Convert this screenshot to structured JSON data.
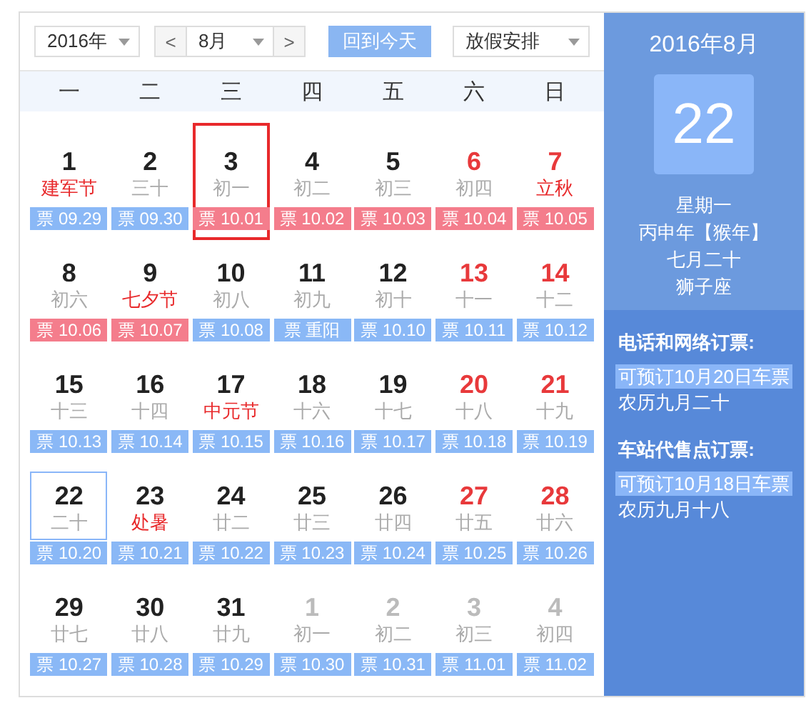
{
  "toolbar": {
    "year": "2016年",
    "prev": "<",
    "month": "8月",
    "next": ">",
    "today_button": "回到今天",
    "holiday_select": "放假安排"
  },
  "weekdays": [
    "一",
    "二",
    "三",
    "四",
    "五",
    "六",
    "日"
  ],
  "days": [
    {
      "day": "1",
      "lunar": "建军节",
      "festival": true,
      "kind": "weekday",
      "ticket": "票 09.29",
      "holiday": false,
      "selected": false,
      "today": false
    },
    {
      "day": "2",
      "lunar": "三十",
      "festival": false,
      "kind": "weekday",
      "ticket": "票 09.30",
      "holiday": false,
      "selected": false,
      "today": false
    },
    {
      "day": "3",
      "lunar": "初一",
      "festival": false,
      "kind": "weekday",
      "ticket": "票 10.01",
      "holiday": true,
      "selected": true,
      "today": false
    },
    {
      "day": "4",
      "lunar": "初二",
      "festival": false,
      "kind": "weekday",
      "ticket": "票 10.02",
      "holiday": true,
      "selected": false,
      "today": false
    },
    {
      "day": "5",
      "lunar": "初三",
      "festival": false,
      "kind": "weekday",
      "ticket": "票 10.03",
      "holiday": true,
      "selected": false,
      "today": false
    },
    {
      "day": "6",
      "lunar": "初四",
      "festival": false,
      "kind": "weekend",
      "ticket": "票 10.04",
      "holiday": true,
      "selected": false,
      "today": false
    },
    {
      "day": "7",
      "lunar": "立秋",
      "festival": true,
      "kind": "weekend",
      "ticket": "票 10.05",
      "holiday": true,
      "selected": false,
      "today": false
    },
    {
      "day": "8",
      "lunar": "初六",
      "festival": false,
      "kind": "weekday",
      "ticket": "票 10.06",
      "holiday": true,
      "selected": false,
      "today": false
    },
    {
      "day": "9",
      "lunar": "七夕节",
      "festival": true,
      "kind": "weekday",
      "ticket": "票 10.07",
      "holiday": true,
      "selected": false,
      "today": false
    },
    {
      "day": "10",
      "lunar": "初八",
      "festival": false,
      "kind": "weekday",
      "ticket": "票 10.08",
      "holiday": false,
      "selected": false,
      "today": false
    },
    {
      "day": "11",
      "lunar": "初九",
      "festival": false,
      "kind": "weekday",
      "ticket": "票 重阳",
      "holiday": false,
      "selected": false,
      "today": false
    },
    {
      "day": "12",
      "lunar": "初十",
      "festival": false,
      "kind": "weekday",
      "ticket": "票 10.10",
      "holiday": false,
      "selected": false,
      "today": false
    },
    {
      "day": "13",
      "lunar": "十一",
      "festival": false,
      "kind": "weekend",
      "ticket": "票 10.11",
      "holiday": false,
      "selected": false,
      "today": false
    },
    {
      "day": "14",
      "lunar": "十二",
      "festival": false,
      "kind": "weekend",
      "ticket": "票 10.12",
      "holiday": false,
      "selected": false,
      "today": false
    },
    {
      "day": "15",
      "lunar": "十三",
      "festival": false,
      "kind": "weekday",
      "ticket": "票 10.13",
      "holiday": false,
      "selected": false,
      "today": false
    },
    {
      "day": "16",
      "lunar": "十四",
      "festival": false,
      "kind": "weekday",
      "ticket": "票 10.14",
      "holiday": false,
      "selected": false,
      "today": false
    },
    {
      "day": "17",
      "lunar": "中元节",
      "festival": true,
      "kind": "weekday",
      "ticket": "票 10.15",
      "holiday": false,
      "selected": false,
      "today": false
    },
    {
      "day": "18",
      "lunar": "十六",
      "festival": false,
      "kind": "weekday",
      "ticket": "票 10.16",
      "holiday": false,
      "selected": false,
      "today": false
    },
    {
      "day": "19",
      "lunar": "十七",
      "festival": false,
      "kind": "weekday",
      "ticket": "票 10.17",
      "holiday": false,
      "selected": false,
      "today": false
    },
    {
      "day": "20",
      "lunar": "十八",
      "festival": false,
      "kind": "weekend",
      "ticket": "票 10.18",
      "holiday": false,
      "selected": false,
      "today": false
    },
    {
      "day": "21",
      "lunar": "十九",
      "festival": false,
      "kind": "weekend",
      "ticket": "票 10.19",
      "holiday": false,
      "selected": false,
      "today": false
    },
    {
      "day": "22",
      "lunar": "二十",
      "festival": false,
      "kind": "weekday",
      "ticket": "票 10.20",
      "holiday": false,
      "selected": false,
      "today": true
    },
    {
      "day": "23",
      "lunar": "处暑",
      "festival": true,
      "kind": "weekday",
      "ticket": "票 10.21",
      "holiday": false,
      "selected": false,
      "today": false
    },
    {
      "day": "24",
      "lunar": "廿二",
      "festival": false,
      "kind": "weekday",
      "ticket": "票 10.22",
      "holiday": false,
      "selected": false,
      "today": false
    },
    {
      "day": "25",
      "lunar": "廿三",
      "festival": false,
      "kind": "weekday",
      "ticket": "票 10.23",
      "holiday": false,
      "selected": false,
      "today": false
    },
    {
      "day": "26",
      "lunar": "廿四",
      "festival": false,
      "kind": "weekday",
      "ticket": "票 10.24",
      "holiday": false,
      "selected": false,
      "today": false
    },
    {
      "day": "27",
      "lunar": "廿五",
      "festival": false,
      "kind": "weekend",
      "ticket": "票 10.25",
      "holiday": false,
      "selected": false,
      "today": false
    },
    {
      "day": "28",
      "lunar": "廿六",
      "festival": false,
      "kind": "weekend",
      "ticket": "票 10.26",
      "holiday": false,
      "selected": false,
      "today": false
    },
    {
      "day": "29",
      "lunar": "廿七",
      "festival": false,
      "kind": "weekday",
      "ticket": "票 10.27",
      "holiday": false,
      "selected": false,
      "today": false
    },
    {
      "day": "30",
      "lunar": "廿八",
      "festival": false,
      "kind": "weekday",
      "ticket": "票 10.28",
      "holiday": false,
      "selected": false,
      "today": false
    },
    {
      "day": "31",
      "lunar": "廿九",
      "festival": false,
      "kind": "weekday",
      "ticket": "票 10.29",
      "holiday": false,
      "selected": false,
      "today": false
    },
    {
      "day": "1",
      "lunar": "初一",
      "festival": false,
      "kind": "other_month",
      "ticket": "票 10.30",
      "holiday": false,
      "selected": false,
      "today": false
    },
    {
      "day": "2",
      "lunar": "初二",
      "festival": false,
      "kind": "other_month",
      "ticket": "票 10.31",
      "holiday": false,
      "selected": false,
      "today": false
    },
    {
      "day": "3",
      "lunar": "初三",
      "festival": false,
      "kind": "other_month",
      "ticket": "票 11.01",
      "holiday": false,
      "selected": false,
      "today": false
    },
    {
      "day": "4",
      "lunar": "初四",
      "festival": false,
      "kind": "other_month",
      "ticket": "票 11.02",
      "holiday": false,
      "selected": false,
      "today": false
    }
  ],
  "side_panel": {
    "month_title": "2016年8月",
    "big_date": "22",
    "details": [
      "星期一",
      "丙申年【猴年】",
      "七月二十",
      "狮子座"
    ],
    "sections": [
      {
        "heading": "电话和网络订票:",
        "notice": "可预订10月20日车票",
        "lunar": "农历九月二十"
      },
      {
        "heading": "车站代售点订票:",
        "notice": "可预订10月18日车票",
        "lunar": "农历九月十八"
      }
    ]
  }
}
